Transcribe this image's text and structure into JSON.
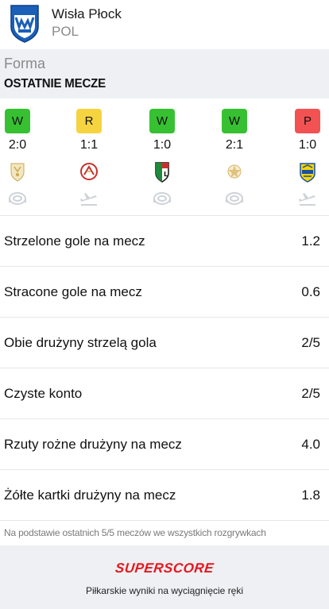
{
  "header": {
    "club_name": "Wisła Płock",
    "country": "POL",
    "logo_icon": "wisla-plock-crest-icon"
  },
  "form": {
    "section_label": "Forma",
    "title": "OSTATNIE MECZE",
    "matches": [
      {
        "result": "W",
        "result_color": "#37c132",
        "score": "2:0",
        "opponent_logo": "opponent-crest-icon",
        "venue": "home"
      },
      {
        "result": "R",
        "result_color": "#f6d341",
        "score": "1:1",
        "opponent_logo": "widzew-crest-icon",
        "venue": "away"
      },
      {
        "result": "W",
        "result_color": "#37c132",
        "score": "1:0",
        "opponent_logo": "legia-crest-icon",
        "venue": "home"
      },
      {
        "result": "W",
        "result_color": "#37c132",
        "score": "2:1",
        "opponent_logo": "opponent-crest-icon",
        "venue": "home"
      },
      {
        "result": "P",
        "result_color": "#f25252",
        "score": "1:0",
        "opponent_logo": "arka-crest-icon",
        "venue": "away"
      }
    ]
  },
  "stats": [
    {
      "label": "Strzelone gole na mecz",
      "value": "1.2"
    },
    {
      "label": "Stracone gole na mecz",
      "value": "0.6"
    },
    {
      "label": "Obie drużyny strzelą gola",
      "value": "2/5"
    },
    {
      "label": "Czyste konto",
      "value": "2/5"
    },
    {
      "label": "Rzuty rożne drużyny na mecz",
      "value": "4.0"
    },
    {
      "label": "Żółte kartki drużyny na mecz",
      "value": "1.8"
    }
  ],
  "footnote": "Na podstawie ostatnich 5/5 meczów we wszystkich rozgrywkach",
  "promo": {
    "brand": "SUPERSCORE",
    "tagline": "Piłkarskie wyniki na wyciągnięcie ręki",
    "brand_color": "#e8171f"
  }
}
